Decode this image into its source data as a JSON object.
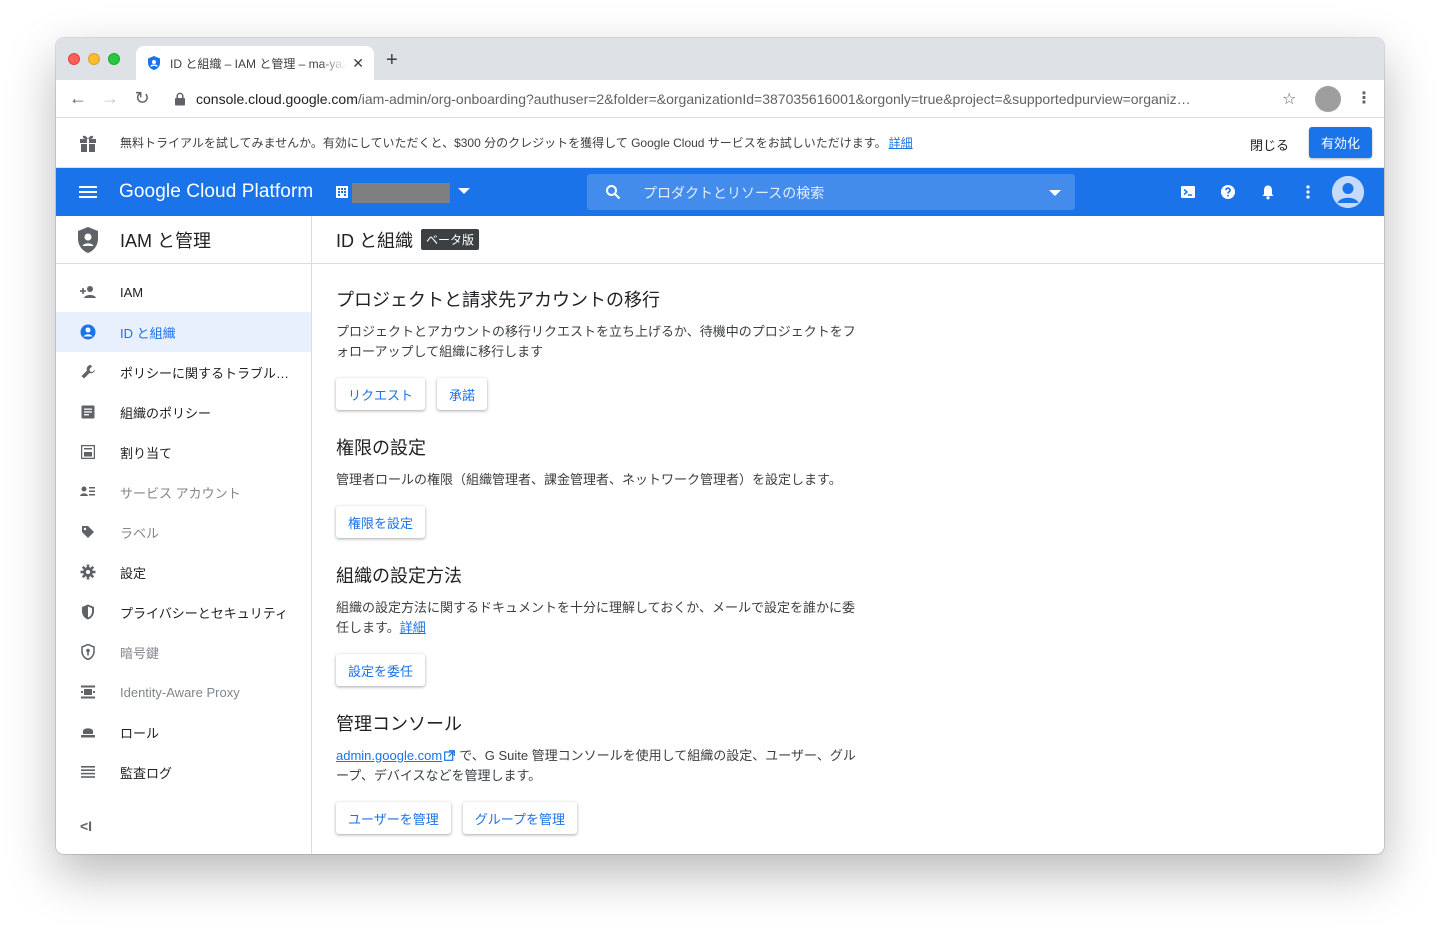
{
  "browser": {
    "tab_title": "ID と組織 – IAM と管理 – ma-yaz",
    "tab_close": "✕",
    "new_tab": "+",
    "back": "←",
    "forward": "→",
    "reload": "↻",
    "url_host": "console.cloud.google.com",
    "url_path": "/iam-admin/org-onboarding?authuser=2&folder=&organizationId=387035616001&orgonly=true&project=&supportedpurview=organiz…",
    "bookmark": "☆",
    "menu": "⋮"
  },
  "banner": {
    "text": "無料トライアルを試してみませんか。有効にしていただくと、$300 分のクレジットを獲得して Google Cloud サービスをお試しいただけます。",
    "link": "詳細",
    "dismiss": "閉じる",
    "activate": "有効化"
  },
  "topnav": {
    "brand": "Google Cloud Platform",
    "search_placeholder": "プロダクトとリソースの検索",
    "icons": [
      "cloud-shell-icon",
      "help-icon",
      "notifications-icon",
      "more-vert-icon"
    ]
  },
  "sidebar": {
    "title": "IAM と管理",
    "items": [
      {
        "label": "IAM",
        "icon": "person-add-icon",
        "state": "normal"
      },
      {
        "label": "ID と組織",
        "icon": "account-circle-icon",
        "state": "active"
      },
      {
        "label": "ポリシーに関するトラブルシューティング",
        "icon": "wrench-icon",
        "state": "normal"
      },
      {
        "label": "組織のポリシー",
        "icon": "policy-doc-icon",
        "state": "normal"
      },
      {
        "label": "割り当て",
        "icon": "quota-icon",
        "state": "normal"
      },
      {
        "label": "サービス アカウント",
        "icon": "service-account-icon",
        "state": "muted"
      },
      {
        "label": "ラベル",
        "icon": "label-icon",
        "state": "muted"
      },
      {
        "label": "設定",
        "icon": "settings-icon",
        "state": "normal"
      },
      {
        "label": "プライバシーとセキュリティ",
        "icon": "shield-icon",
        "state": "normal"
      },
      {
        "label": "暗号鍵",
        "icon": "key-shield-icon",
        "state": "muted"
      },
      {
        "label": "Identity-Aware Proxy",
        "icon": "iap-icon",
        "state": "muted"
      },
      {
        "label": "ロール",
        "icon": "roles-icon",
        "state": "normal"
      },
      {
        "label": "監査ログ",
        "icon": "audit-log-icon",
        "state": "normal"
      }
    ],
    "collapse": "<I"
  },
  "main": {
    "title": "ID と組織",
    "badge": "ベータ版",
    "sections": {
      "migrate": {
        "title": "プロジェクトと請求先アカウントの移行",
        "desc": "プロジェクトとアカウントの移行リクエストを立ち上げるか、待機中のプロジェクトをフォローアップして組織に移行します",
        "buttons": [
          "リクエスト",
          "承諾"
        ]
      },
      "permissions": {
        "title": "権限の設定",
        "desc": "管理者ロールの権限（組織管理者、課金管理者、ネットワーク管理者）を設定します。",
        "buttons": [
          "権限を設定"
        ]
      },
      "setup": {
        "title": "組織の設定方法",
        "desc": "組織の設定方法に関するドキュメントを十分に理解しておくか、メールで設定を誰かに委任します。",
        "link": "詳細",
        "buttons": [
          "設定を委任"
        ]
      },
      "admin": {
        "title": "管理コンソール",
        "link": "admin.google.com",
        "desc": "で、G Suite 管理コンソールを使用して組織の設定、ユーザー、グループ、デバイスなどを管理します。",
        "buttons": [
          "ユーザーを管理",
          "グループを管理"
        ]
      }
    }
  },
  "colors": {
    "brand_blue": "#1a73e8",
    "active_bg": "#e8f0fe"
  }
}
